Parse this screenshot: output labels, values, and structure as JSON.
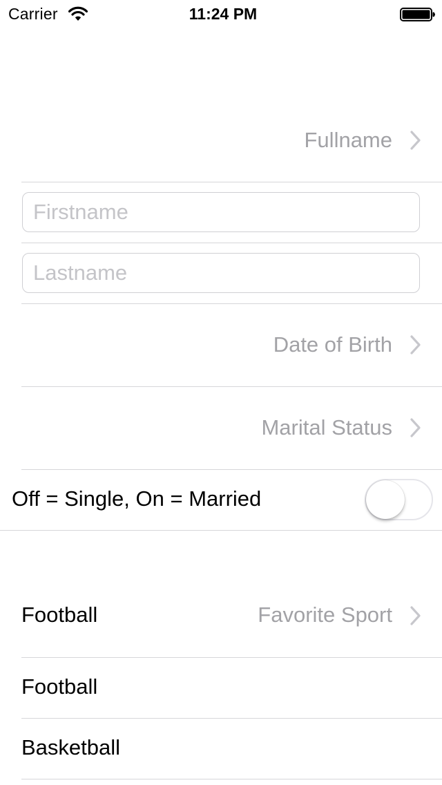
{
  "status_bar": {
    "carrier": "Carrier",
    "time": "11:24 PM",
    "wifi_icon": "wifi-icon",
    "battery_icon": "battery-full-icon"
  },
  "form": {
    "fullname_label": "Fullname",
    "firstname_placeholder": "Firstname",
    "lastname_placeholder": "Lastname",
    "firstname_value": "",
    "lastname_value": "",
    "dob_label": "Date of Birth",
    "marital_status_label": "Marital Status",
    "marital_switch_label": "Off = Single, On = Married",
    "marital_switch_on": false
  },
  "sport": {
    "selected": "Football",
    "label": "Favorite Sport",
    "options": [
      "Football",
      "Basketball"
    ]
  },
  "colors": {
    "secondary_text": "#a2a2a6",
    "separator": "#d6d6d9",
    "placeholder": "#c4c4c8"
  }
}
